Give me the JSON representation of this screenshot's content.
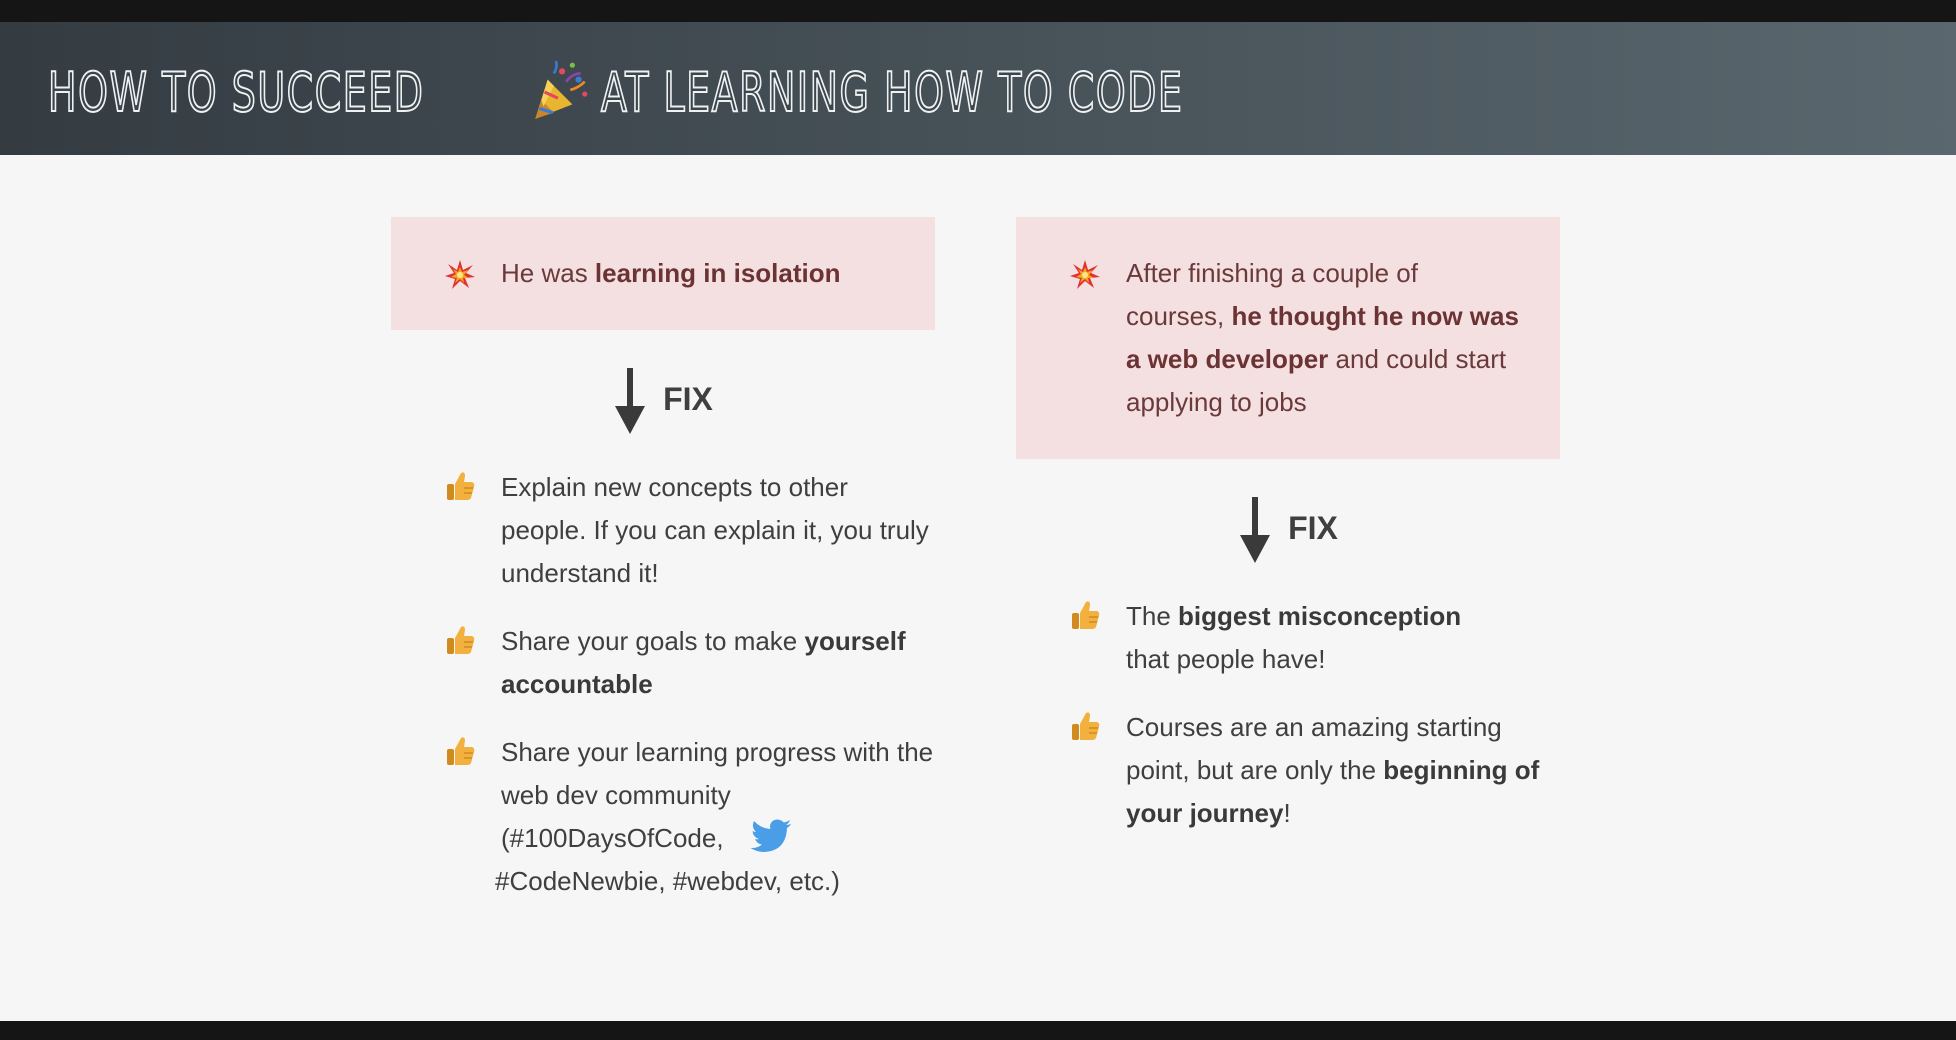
{
  "header": {
    "title_part1": "HOW TO SUCCEED",
    "title_icon": "party-popper-icon",
    "title_part2": "AT LEARNING HOW TO CODE"
  },
  "columns": [
    {
      "problem": {
        "icon": "collision-icon",
        "segments": [
          {
            "text": "He was ",
            "bold": false
          },
          {
            "text": "learning in isolation",
            "bold": true
          }
        ]
      },
      "fix_label": "FIX",
      "items": [
        {
          "icon": "thumbs-up-icon",
          "segments": [
            {
              "text": "Explain new concepts to other people. If you can explain it, you truly understand it!",
              "bold": false
            }
          ]
        },
        {
          "icon": "thumbs-up-icon",
          "segments": [
            {
              "text": "Share your goals to make ",
              "bold": false
            },
            {
              "text": "yourself accountable",
              "bold": true
            }
          ]
        },
        {
          "icon": "thumbs-up-icon",
          "segments": [
            {
              "text": "Share your learning progress with the web dev community (#100DaysOfCode,",
              "bold": false
            },
            {
              "icon": "twitter-icon"
            },
            {
              "text": " #CodeNewbie, #webdev, etc.)",
              "bold": false
            }
          ]
        }
      ]
    },
    {
      "problem": {
        "icon": "collision-icon",
        "segments": [
          {
            "text": "After finishing a couple of courses, ",
            "bold": false
          },
          {
            "text": "he thought he now was a web developer",
            "bold": true
          },
          {
            "text": " and could start applying to jobs",
            "bold": false
          }
        ]
      },
      "fix_label": "FIX",
      "items": [
        {
          "icon": "thumbs-up-icon",
          "segments": [
            {
              "text": "The ",
              "bold": false
            },
            {
              "text": "biggest misconception",
              "bold": true
            },
            {
              "text": " that people have!",
              "bold": false
            }
          ]
        },
        {
          "icon": "thumbs-up-icon",
          "segments": [
            {
              "text": "Courses are an amazing starting point, but are only the ",
              "bold": false
            },
            {
              "text": "beginning of your journey",
              "bold": true
            },
            {
              "text": "!",
              "bold": false
            }
          ]
        }
      ]
    }
  ],
  "colors": {
    "header_start": "#343c42",
    "header_end": "#5a676e",
    "problem_bg": "#f4dfe1",
    "problem_text": "#6a3a3a",
    "body_text": "#3f3f3f",
    "twitter_blue": "#4a9ee8",
    "thumb_yellow": "#f2b13e"
  }
}
